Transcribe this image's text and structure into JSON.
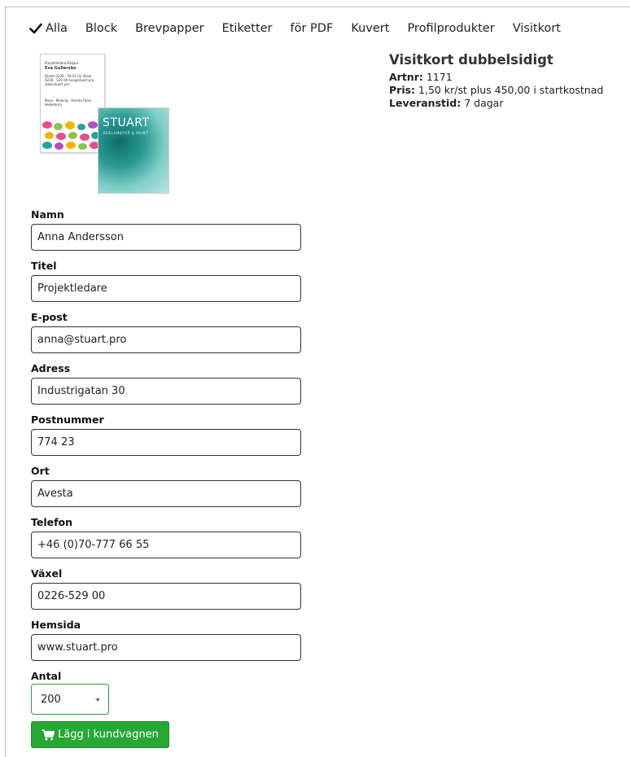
{
  "nav": {
    "items": [
      {
        "label": "Alla",
        "active": true
      },
      {
        "label": "Block"
      },
      {
        "label": "Brevpapper"
      },
      {
        "label": "Etiketter"
      },
      {
        "label": "för PDF"
      },
      {
        "label": "Kuvert"
      },
      {
        "label": "Profilprodukter"
      },
      {
        "label": "Visitkort"
      }
    ]
  },
  "preview": {
    "front": {
      "role": "Projektledare/Säljare",
      "name": "Eva Gullersbo",
      "contact": "Direkt 0226 - 59 03 02 Växel 0226 - 529 00 eva@stuart.pro www.stuart.pro",
      "locations": "Mora · Malung · Avesta Falun · Hedemora"
    },
    "back": {
      "logo": "STUART",
      "tagline": "REKLAMBYRÅ & PRINT"
    }
  },
  "product": {
    "title": "Visitkort dubbelsidigt",
    "artnr_label": "Artnr:",
    "artnr_value": "1171",
    "pris_label": "Pris:",
    "pris_value": "1,50 kr/st plus 450,00 i startkostnad",
    "leverans_label": "Leveranstid:",
    "leverans_value": "7 dagar"
  },
  "form": {
    "fields": [
      {
        "label": "Namn",
        "value": "Anna Andersson"
      },
      {
        "label": "Titel",
        "value": "Projektledare"
      },
      {
        "label": "E-post",
        "value": "anna@stuart.pro"
      },
      {
        "label": "Adress",
        "value": "Industrigatan 30"
      },
      {
        "label": "Postnummer",
        "value": "774 23"
      },
      {
        "label": "Ort",
        "value": "Avesta"
      },
      {
        "label": "Telefon",
        "value": "+46 (0)70-777 66 55"
      },
      {
        "label": "Växel",
        "value": "0226-529 00"
      },
      {
        "label": "Hemsida",
        "value": "www.stuart.pro"
      }
    ],
    "quantity_label": "Antal",
    "quantity_value": "200",
    "add_to_cart_label": "Lägg i kundvagnen"
  },
  "colors": {
    "accent_green": "#26a834",
    "text": "#222222"
  },
  "icons": {
    "active_nav": "check-icon",
    "cart_button": "cart-icon"
  }
}
